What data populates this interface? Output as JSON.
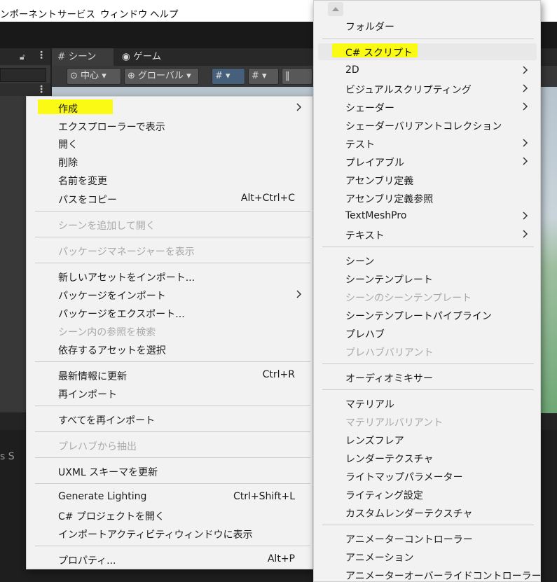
{
  "menubar": {
    "items": [
      "ンポーネント",
      "サービス",
      "ウィンドウ",
      "ヘルプ"
    ]
  },
  "scene_view": {
    "tabs": [
      {
        "label": "シーン",
        "icon": "hash-icon"
      },
      {
        "label": "ゲーム",
        "icon": "gamepad-icon"
      }
    ],
    "toolbar": {
      "pivot": "中心",
      "space": "グローバル"
    }
  },
  "bottom_panel": {
    "breadcrumb": "s  S"
  },
  "context_menu": {
    "items": [
      {
        "label": "作成",
        "submenu": true,
        "highlighted": true
      },
      {
        "label": "エクスプローラーで表示"
      },
      {
        "label": "開く"
      },
      {
        "label": "削除"
      },
      {
        "label": "名前を変更"
      },
      {
        "label": "パスをコピー",
        "shortcut": "Alt+Ctrl+C"
      },
      {
        "label": "シーンを追加して開く",
        "disabled": true
      },
      {
        "label": "パッケージマネージャーを表示",
        "disabled": true
      },
      {
        "label": "新しいアセットをインポート..."
      },
      {
        "label": "パッケージをインポート",
        "submenu": true
      },
      {
        "label": "パッケージをエクスポート..."
      },
      {
        "label": "シーン内の参照を検索",
        "disabled": true
      },
      {
        "label": "依存するアセットを選択"
      },
      {
        "label": "最新情報に更新",
        "shortcut": "Ctrl+R"
      },
      {
        "label": "再インポート"
      },
      {
        "label": "すべてを再インポート"
      },
      {
        "label": "プレハブから抽出",
        "disabled": true
      },
      {
        "label": "UXML スキーマを更新"
      },
      {
        "label": "Generate Lighting",
        "shortcut": "Ctrl+Shift+L"
      },
      {
        "label": "C# プロジェクトを開く"
      },
      {
        "label": "インポートアクティビティウィンドウに表示"
      },
      {
        "label": "プロパティ...",
        "shortcut": "Alt+P"
      }
    ]
  },
  "create_submenu": {
    "items": [
      {
        "label": "フォルダー"
      },
      {
        "label": "C# スクリプト",
        "highlighted": true
      },
      {
        "label": "2D",
        "submenu": true
      },
      {
        "label": "ビジュアルスクリプティング",
        "submenu": true
      },
      {
        "label": "シェーダー",
        "submenu": true
      },
      {
        "label": "シェーダーバリアントコレクション"
      },
      {
        "label": "テスト",
        "submenu": true
      },
      {
        "label": "プレイアブル",
        "submenu": true
      },
      {
        "label": "アセンブリ定義"
      },
      {
        "label": "アセンブリ定義参照"
      },
      {
        "label": "TextMeshPro",
        "submenu": true
      },
      {
        "label": "テキスト",
        "submenu": true
      },
      {
        "label": "シーン"
      },
      {
        "label": "シーンテンプレート"
      },
      {
        "label": "シーンのシーンテンプレート",
        "disabled": true
      },
      {
        "label": "シーンテンプレートパイプライン"
      },
      {
        "label": "プレハブ"
      },
      {
        "label": "プレハブバリアント",
        "disabled": true
      },
      {
        "label": "オーディオミキサー"
      },
      {
        "label": "マテリアル"
      },
      {
        "label": "マテリアルバリアント",
        "disabled": true
      },
      {
        "label": "レンズフレア"
      },
      {
        "label": "レンダーテクスチャ"
      },
      {
        "label": "ライトマップパラメーター"
      },
      {
        "label": "ライティング設定"
      },
      {
        "label": "カスタムレンダーテクスチャ"
      },
      {
        "label": "アニメーターコントローラー"
      },
      {
        "label": "アニメーション"
      },
      {
        "label": "アニメーターオーバーライドコントローラー"
      }
    ]
  },
  "colors": {
    "highlight": "#fafa14",
    "menu_bg": "#f2f2f2",
    "disabled_text": "#a9a9a9",
    "editor_dark": "#383838"
  }
}
